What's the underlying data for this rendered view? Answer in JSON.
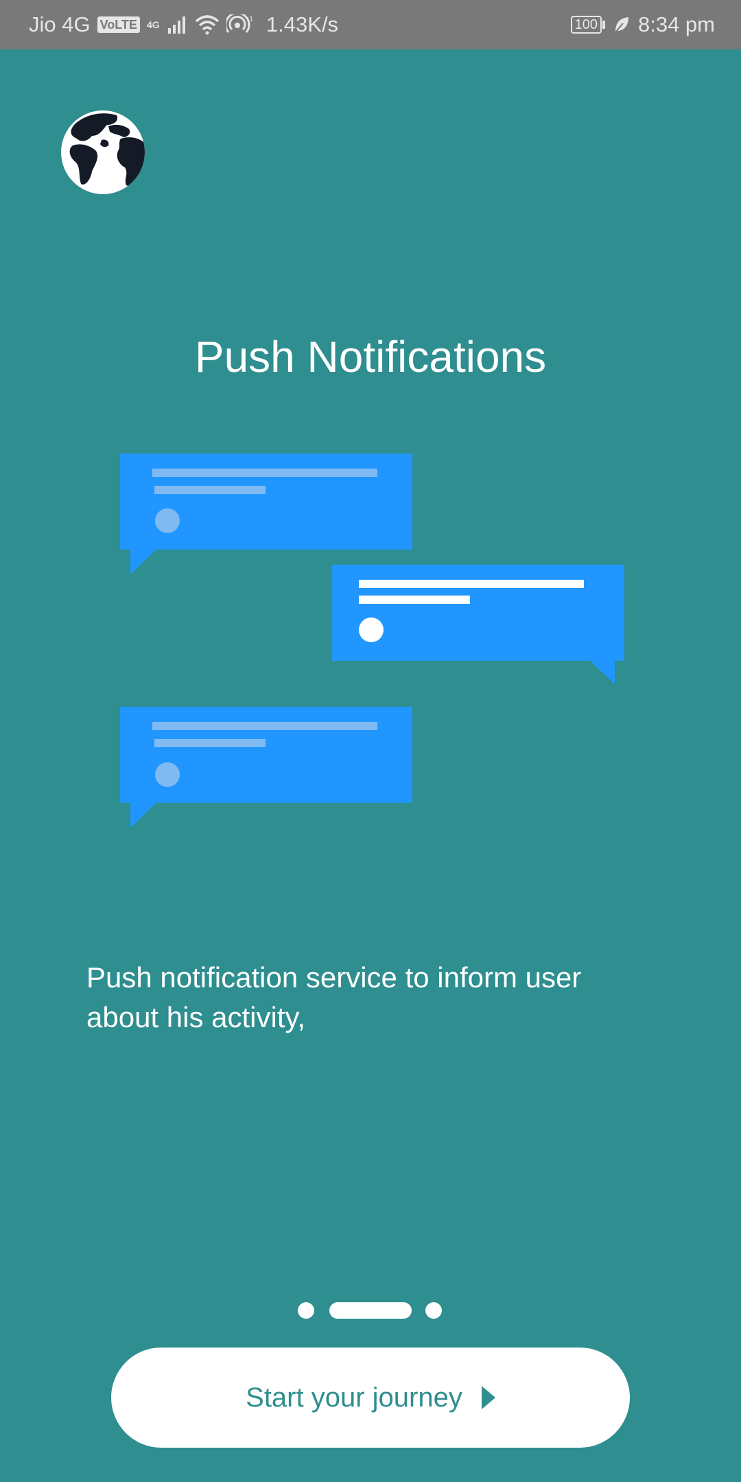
{
  "status_bar": {
    "carrier": "Jio 4G",
    "volte": "VoLTE",
    "network": "4G",
    "speed": "1.43K/s",
    "battery": "100",
    "time": "8:34 pm"
  },
  "onboarding": {
    "title": "Push Notifications",
    "description": "Push notification service to inform user about his activity,",
    "page_count": 3,
    "active_page": 2
  },
  "cta": {
    "label": "Start your journey"
  },
  "colors": {
    "background": "#2f8e8f",
    "bubble": "#2196fe",
    "status_bar": "#797979"
  }
}
